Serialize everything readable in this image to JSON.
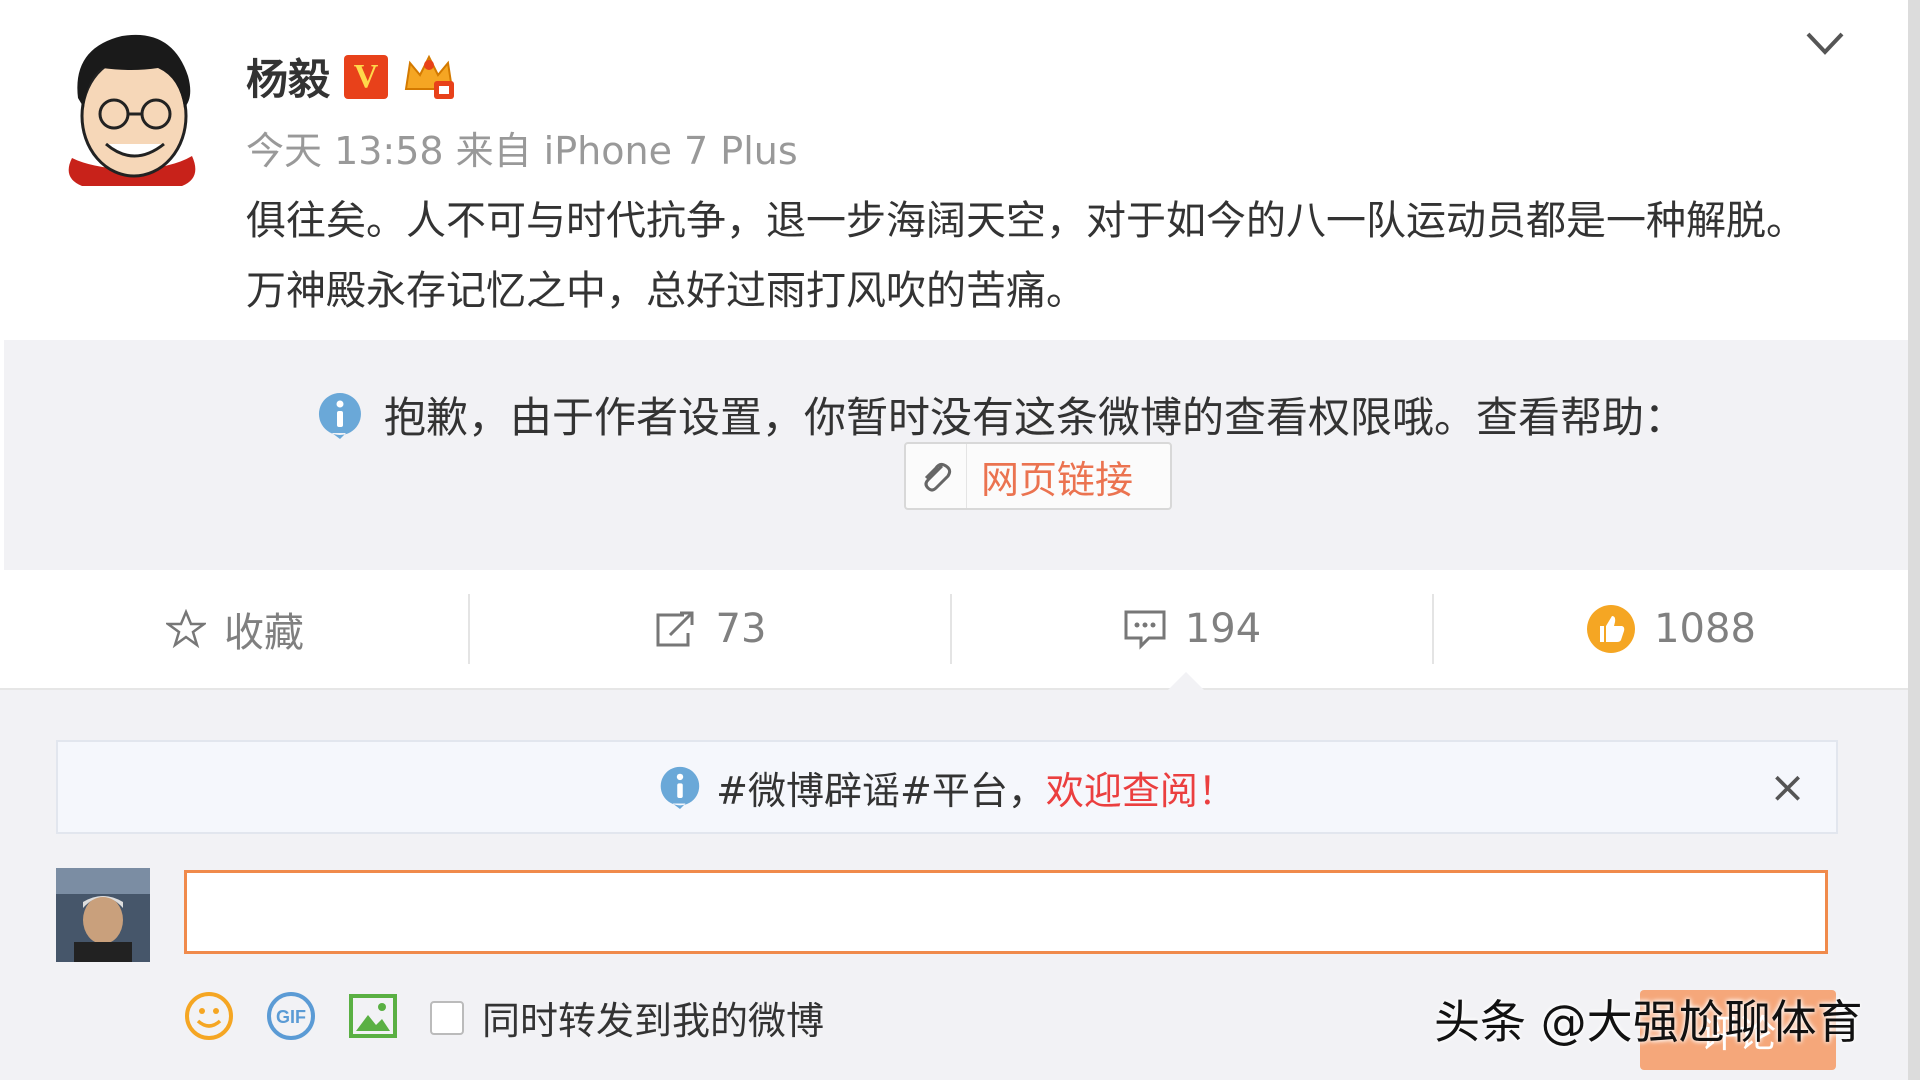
{
  "post": {
    "author_name": "杨毅",
    "verified_badge": "V",
    "time": "今天 13:58",
    "source": "来自 iPhone 7 Plus",
    "content": "俱往矣。人不可与时代抗争，退一步海阔天空，对于如今的八一队运动员都是一种解脱。万神殿永存记忆之中，总好过雨打风吹的苦痛。"
  },
  "restriction": {
    "message": "抱歉，由于作者设置，你暂时没有这条微博的查看权限哦。查看帮助：",
    "link_label": "网页链接"
  },
  "actions": {
    "favorite_label": "收藏",
    "repost_count": "73",
    "comment_count": "194",
    "like_count": "1088"
  },
  "comment_area": {
    "notice_text": "#微博辟谣#平台，",
    "notice_highlight": "欢迎查阅！",
    "notice_close": "×",
    "input_value": "",
    "repost_checkbox_label": "同时转发到我的微博",
    "submit_label": "评论"
  },
  "watermark": "头条 @大强尬聊体育",
  "icons": [
    "star-icon",
    "repost-icon",
    "comment-icon",
    "thumb-up-icon",
    "info-icon",
    "paperclip-icon",
    "emoji-icon",
    "gif-icon",
    "image-icon",
    "chevron-down-icon",
    "close-icon",
    "crown-icon"
  ],
  "colors": {
    "accent_orange": "#eb7350",
    "input_border": "#f08a4b",
    "verified_red": "#e8411a",
    "info_blue": "#6aa8d8",
    "highlight_red": "#eb3f3f"
  }
}
